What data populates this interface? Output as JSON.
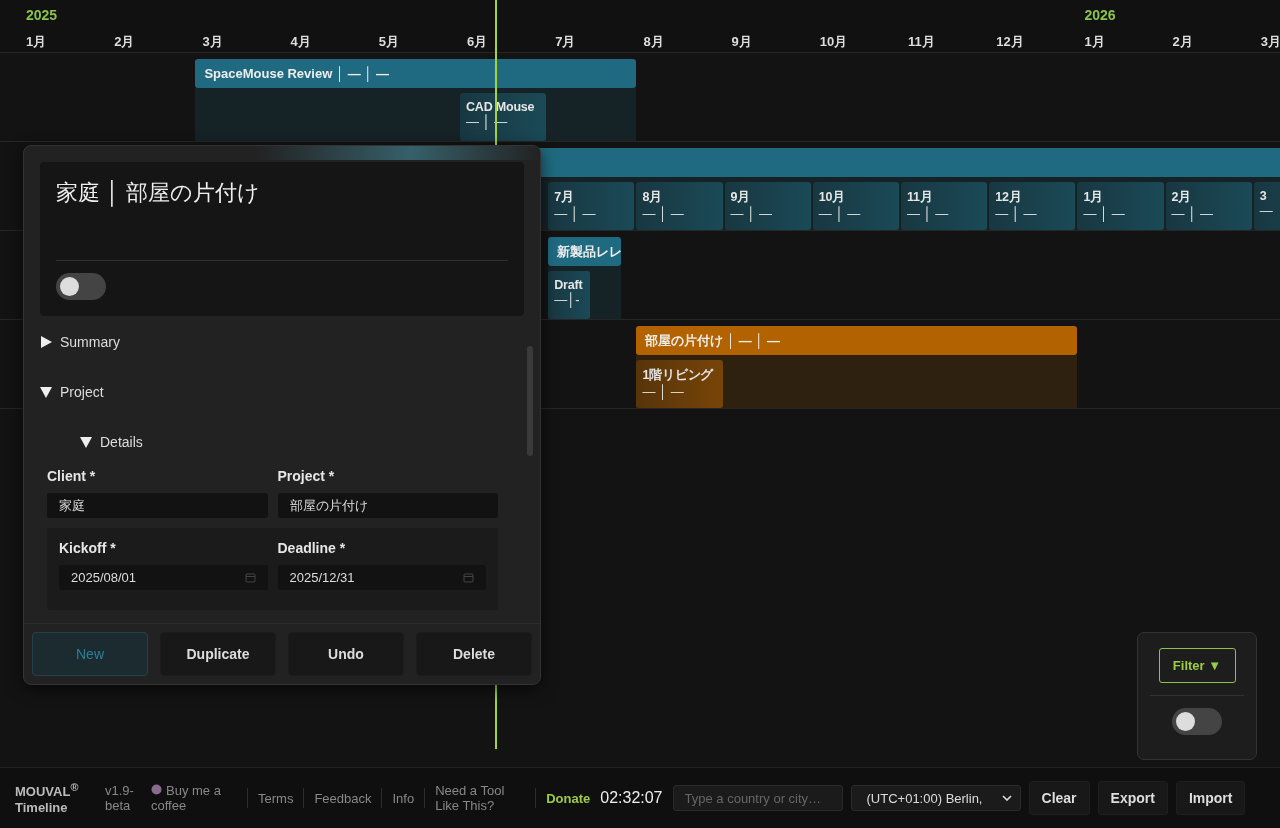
{
  "timeline": {
    "years": [
      "2025",
      "2026"
    ],
    "months": [
      "1月",
      "2月",
      "3月",
      "4月",
      "5月",
      "6月",
      "7月",
      "8月",
      "9月",
      "10月",
      "11月",
      "12月",
      "1月",
      "2月",
      "3月"
    ],
    "lanes": [
      {
        "bar": {
          "label": "SpaceMouse Review │ — │ —",
          "color": "#1f6a80"
        },
        "children": [
          {
            "title": "CAD Mouse",
            "sub": "— │ —"
          }
        ]
      },
      {
        "bar": {
          "color": "#1f6a80"
        },
        "children": [
          {
            "title": "7月",
            "sub": "— │ —"
          },
          {
            "title": "8月",
            "sub": "— │ —"
          },
          {
            "title": "9月",
            "sub": "— │ —"
          },
          {
            "title": "10月",
            "sub": "— │ —"
          },
          {
            "title": "11月",
            "sub": "— │ —"
          },
          {
            "title": "12月",
            "sub": "— │ —"
          },
          {
            "title": "1月",
            "sub": "— │ —"
          },
          {
            "title": "2月",
            "sub": "— │ —"
          },
          {
            "title": "3",
            "sub": "—"
          }
        ]
      },
      {
        "bar": {
          "label": "新製品レレ",
          "color": "#1f6a80"
        },
        "children": [
          {
            "title": "Draft",
            "sub": "—│-"
          }
        ]
      },
      {
        "bar": {
          "label": "部屋の片付け │ — │ —",
          "color": "#b36200"
        },
        "children": [
          {
            "title": "1階リビング",
            "sub": "— │ —"
          }
        ]
      }
    ]
  },
  "dialog": {
    "title": "家庭 │ 部屋の片付け",
    "toggle": {
      "on": false
    },
    "sections": [
      {
        "label": "Summary",
        "expanded": false
      },
      {
        "label": "Project",
        "expanded": true
      }
    ],
    "details": {
      "label": "Details",
      "expanded": true
    },
    "fields": [
      {
        "label": "Client *",
        "value": "家庭"
      },
      {
        "label": "Project *",
        "value": "部屋の片付け"
      }
    ],
    "dates": [
      {
        "label": "Kickoff *",
        "value": "2025/08/01"
      },
      {
        "label": "Deadline *",
        "value": "2025/12/31"
      }
    ],
    "buttons": [
      {
        "label": "New",
        "kind": "accent"
      },
      {
        "label": "Duplicate",
        "kind": "plain"
      },
      {
        "label": "Undo",
        "kind": "plain"
      },
      {
        "label": "Delete",
        "kind": "plain"
      }
    ]
  },
  "filter": {
    "label": "Filter ▼",
    "toggle": {
      "on": false
    }
  },
  "footer": {
    "brand": "MOUVAL$^{®}$",
    "product": "Timeline",
    "version": "v1.9-beta",
    "coffee": "Buy me a coffee",
    "links": [
      "Terms",
      "Feedback",
      "Info",
      "Need a Tool Like This?"
    ],
    "donate": "Donate",
    "clock": "02:32:07",
    "search": {
      "placeholder": "Type a country or city…"
    },
    "timezone": "(UTC+01:00) Berlin,",
    "buttons": [
      "Clear",
      "Export",
      "Import"
    ]
  }
}
